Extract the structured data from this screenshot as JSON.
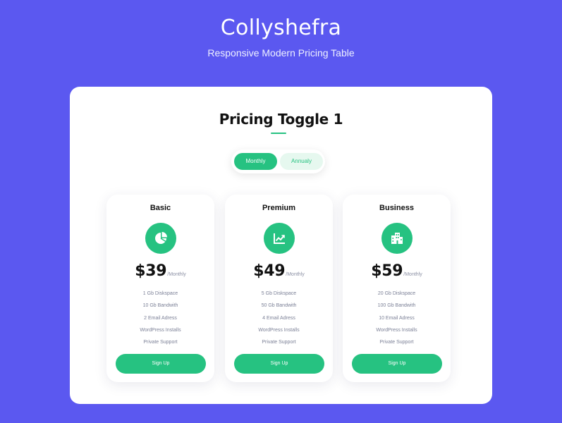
{
  "header": {
    "title": "Collyshefra",
    "subtitle": "Responsive Modern Pricing Table"
  },
  "section": {
    "title": "Pricing Toggle 1"
  },
  "toggle": {
    "monthly_label": "Monthly",
    "annually_label": "Annualy",
    "selected": "Monthly"
  },
  "colors": {
    "background": "#5b58f0",
    "accent": "#26c281",
    "panel": "#ffffff"
  },
  "plans": [
    {
      "name": "Basic",
      "icon": "pie-chart-icon",
      "price": "$39",
      "period": "/Monthly",
      "features": [
        "1 Gb Diskspace",
        "10 Gb Bandwith",
        "2 Email Adress",
        "WordPress Installs",
        "Private Support"
      ],
      "button_label": "Sign Up"
    },
    {
      "name": "Premium",
      "icon": "trending-chart-icon",
      "price": "$49",
      "period": "/Monthly",
      "features": [
        "5 Gb Diskspace",
        "50 Gb Bandwith",
        "4 Email Adress",
        "WordPress Installs",
        "Private Support"
      ],
      "button_label": "Sign Up"
    },
    {
      "name": "Business",
      "icon": "building-icon",
      "price": "$59",
      "period": "/Monthly",
      "features": [
        "20 Gb Diskspace",
        "100 Gb Bandwith",
        "10 Email Adress",
        "WordPress Installs",
        "Private Support"
      ],
      "button_label": "Sign Up"
    }
  ]
}
